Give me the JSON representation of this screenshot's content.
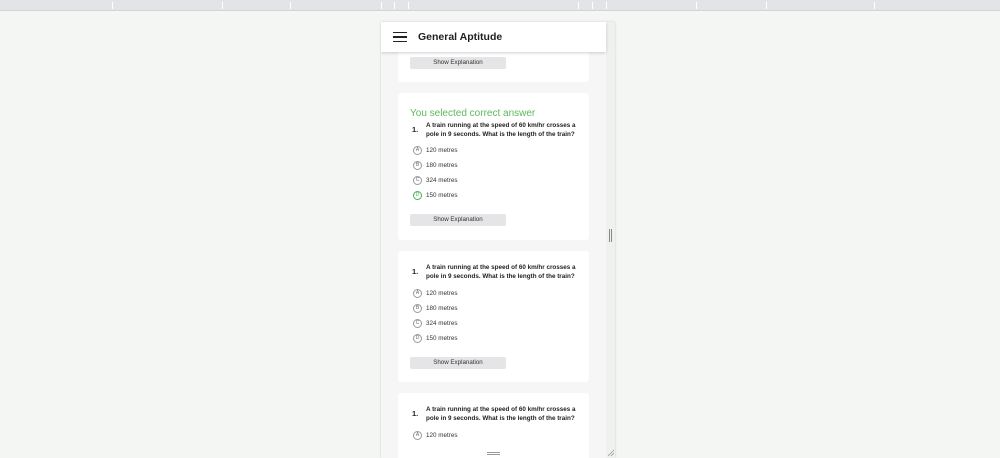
{
  "app": {
    "title": "General Aptitude"
  },
  "labels": {
    "show_explanation": "Show Explanation"
  },
  "card2": {
    "feedback": "You selected correct answer",
    "number": "1.",
    "question": "A train running at the speed of 60 km/hr crosses a pole in 9 seconds. What is the length of the train?",
    "options": [
      {
        "letter": "A",
        "text": "120 metres"
      },
      {
        "letter": "B",
        "text": "180 metres"
      },
      {
        "letter": "C",
        "text": "324 metres"
      },
      {
        "letter": "D",
        "text": "150 metres"
      }
    ],
    "selected": "D"
  },
  "card3": {
    "number": "1.",
    "question": "A train running at the speed of 60 km/hr crosses a pole in 9 seconds. What is the length of the train?",
    "options": [
      {
        "letter": "A",
        "text": "120 metres"
      },
      {
        "letter": "B",
        "text": "180 metres"
      },
      {
        "letter": "C",
        "text": "324 metres"
      },
      {
        "letter": "D",
        "text": "150 metres"
      }
    ]
  },
  "card4": {
    "number": "1.",
    "question": "A train running at the speed of 60 km/hr crosses a pole in 9 seconds. What is the length of the train?",
    "options": [
      {
        "letter": "A",
        "text": "120 metres"
      }
    ]
  },
  "colors": {
    "correct": "#5cb85c",
    "selected_ring": "#4caf50"
  }
}
